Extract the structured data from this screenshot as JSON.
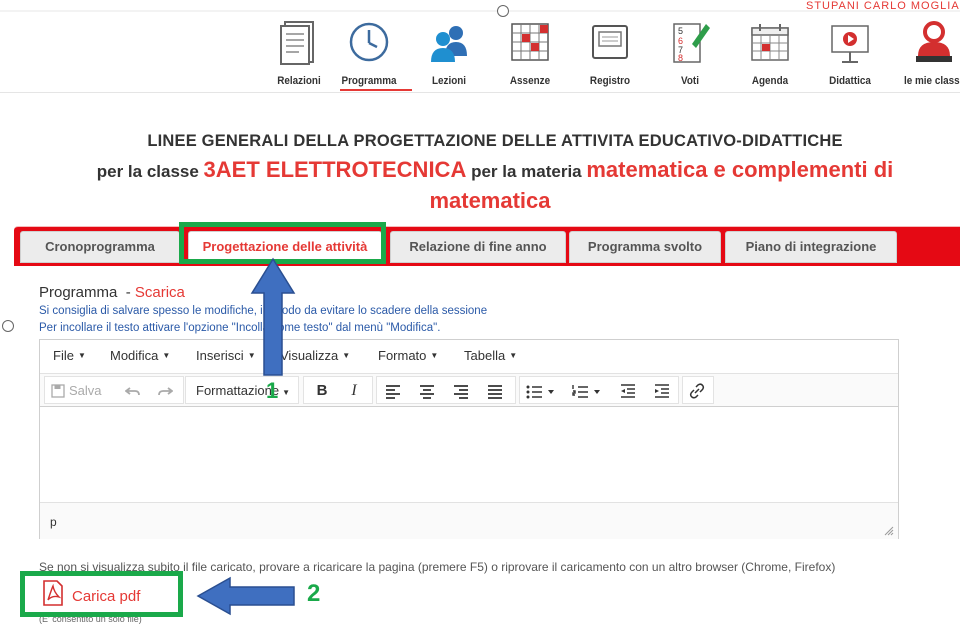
{
  "top_cut_text": "STUPANI CARLO MOGLIA",
  "nav": {
    "items": [
      {
        "label": "Relazioni",
        "icon": "document-icon"
      },
      {
        "label": "Programma",
        "icon": "clock-icon"
      },
      {
        "label": "Lezioni",
        "icon": "people-icon"
      },
      {
        "label": "Assenze",
        "icon": "grid-icon"
      },
      {
        "label": "Registro",
        "icon": "register-icon"
      },
      {
        "label": "Voti",
        "icon": "grades-icon"
      },
      {
        "label": "Agenda",
        "icon": "calendar-icon"
      },
      {
        "label": "Didattica",
        "icon": "presentation-icon"
      },
      {
        "label": "le mie classi",
        "icon": "person-icon"
      }
    ],
    "active": "Programma"
  },
  "heading": {
    "line1": "LINEE GENERALI DELLA PROGETTAZIONE DELLE ATTIVITA EDUCATIVO-DIDATTICHE",
    "line2_prefix": "per la classe ",
    "class_name": "3AET ELETTROTECNICA",
    "line2_middle": " per la materia ",
    "subject_part1": "matematica e complementi di",
    "subject_part2": "matematica"
  },
  "tabs": [
    {
      "label": "Cronoprogramma"
    },
    {
      "label": "Progettazione delle attività",
      "active": true
    },
    {
      "label": "Relazione di fine anno"
    },
    {
      "label": "Programma svolto"
    },
    {
      "label": "Piano di integrazione"
    }
  ],
  "section": {
    "title": "Programma",
    "separator": "  - ",
    "download_link": "Scarica",
    "hint1": "Si consiglia di salvare spesso le modifiche, in modo da evitare lo scadere della sessione",
    "hint2": "Per incollare il testo attivare l'opzione \"Incolla come testo\" dal menù \"Modifica\"."
  },
  "editor": {
    "menus": [
      "File",
      "Modifica",
      "Inserisci",
      "Visualizza",
      "Formato",
      "Tabella"
    ],
    "save_label": "Salva",
    "format_label": "Formattazione",
    "bold": "B",
    "italic": "I",
    "status_path": "p"
  },
  "note": "Se non si visualizza subito il file caricato, provare a ricaricare la pagina (premere F5) o riprovare il caricamento con un altro browser (Chrome, Firefox)",
  "upload": {
    "label": "Carica pdf",
    "sub": "(E' consentito un solo file)"
  },
  "annotations": {
    "num1": "1",
    "num2": "2",
    "box_color": "#1aa94a",
    "arrow_color": "#3f6fc0"
  },
  "colors": {
    "accent_red": "#e53935",
    "tab_bar_red": "#e50914",
    "hint_blue": "#2b5aa8"
  }
}
